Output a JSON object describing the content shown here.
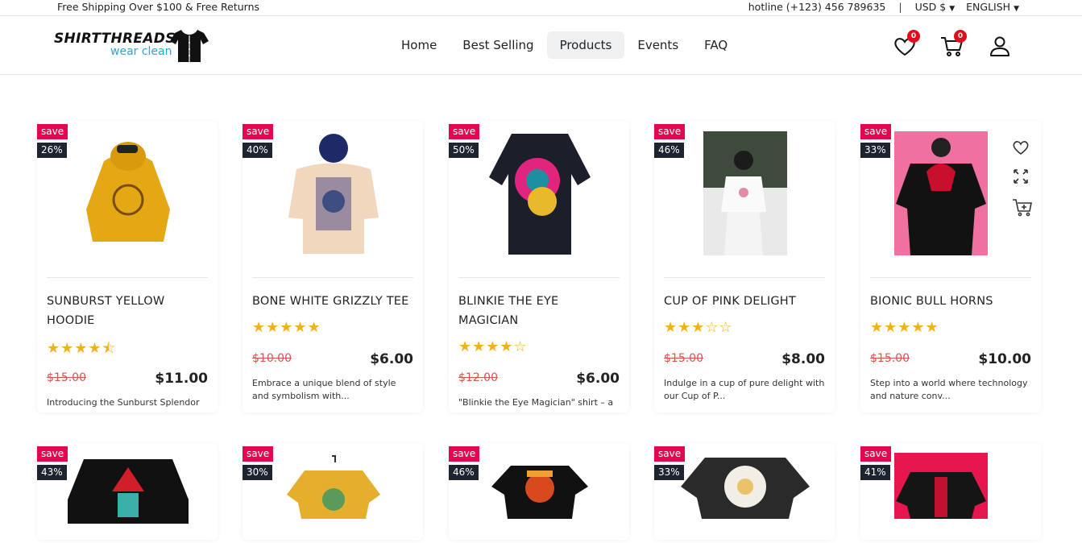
{
  "topbar": {
    "shipping": "Free Shipping Over $100 & Free Returns",
    "hotline": "hotline (+123) 456 789635",
    "separator": "|",
    "currency": "USD $",
    "language": "ENGLISH"
  },
  "brand": {
    "line1": "SHIRTTHREADS",
    "line2": "wear clean",
    "accent": "#2aa6d6"
  },
  "nav": [
    {
      "label": "Home"
    },
    {
      "label": "Best Selling"
    },
    {
      "label": "Products"
    },
    {
      "label": "Events"
    },
    {
      "label": "FAQ"
    }
  ],
  "header_icons": {
    "wishlist_count": "0",
    "cart_count": "0"
  },
  "colors": {
    "save_tag": "#e3074f",
    "pct_tag": "#1c2432",
    "star": "#f2b01e",
    "old_price": "#d9534f",
    "badge": "#e30b1b"
  },
  "products": [
    {
      "save": "save",
      "pct": "26%",
      "name": "SUNBURST YELLOW HOODIE",
      "rating": 4.5,
      "stars": "★★★★⯪",
      "old_price": "$15.00",
      "price": "$11.00",
      "desc": "Introducing the Sunburst Splendor"
    },
    {
      "save": "save",
      "pct": "40%",
      "name": "BONE WHITE GRIZZLY TEE",
      "rating": 5,
      "stars": "★★★★★",
      "old_price": "$10.00",
      "price": "$6.00",
      "desc": "Embrace a unique blend of style and symbolism with..."
    },
    {
      "save": "save",
      "pct": "50%",
      "name": "BLINKIE THE EYE MAGICIAN",
      "rating": 4,
      "stars": "★★★★☆",
      "old_price": "$12.00",
      "price": "$6.00",
      "desc": "\"Blinkie the Eye Magician\" shirt – a"
    },
    {
      "save": "save",
      "pct": "46%",
      "name": "CUP OF PINK DELIGHT",
      "rating": 3,
      "stars": "★★★☆☆",
      "old_price": "$15.00",
      "price": "$8.00",
      "desc": "Indulge in a cup of pure delight with our Cup of P..."
    },
    {
      "save": "save",
      "pct": "33%",
      "name": "BIONIC BULL HORNS",
      "rating": 5,
      "stars": "★★★★★",
      "old_price": "$15.00",
      "price": "$10.00",
      "desc": "Step into a world where technology and nature conv..."
    }
  ],
  "products_row2": [
    {
      "save": "save",
      "pct": "43%"
    },
    {
      "save": "save",
      "pct": "30%"
    },
    {
      "save": "save",
      "pct": "46%"
    },
    {
      "save": "save",
      "pct": "33%"
    },
    {
      "save": "save",
      "pct": "41%"
    }
  ]
}
